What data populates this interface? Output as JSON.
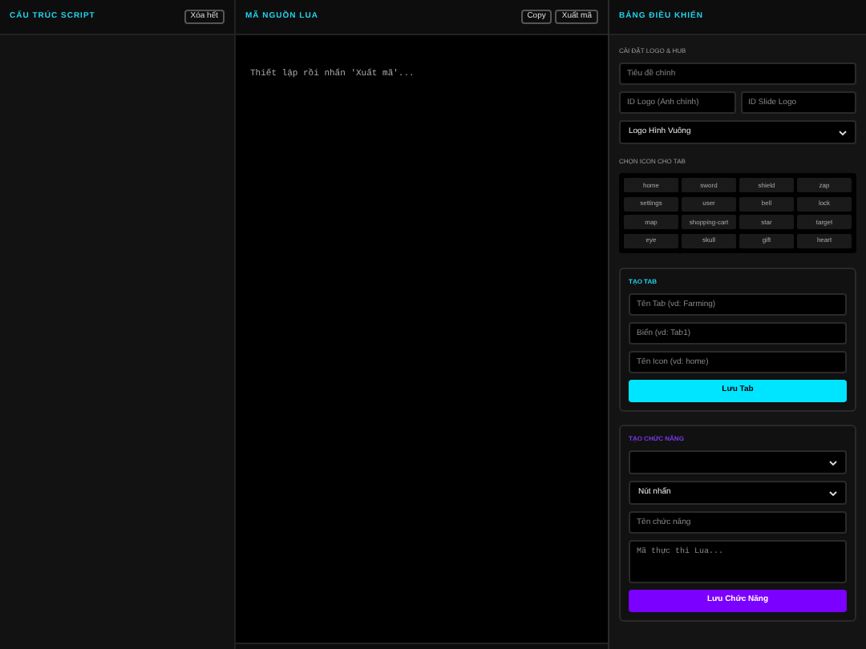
{
  "structure_panel": {
    "title": "CẤU TRÚC SCRIPT",
    "clear_button": "Xóa hết"
  },
  "code_panel": {
    "title": "MÃ NGUỒN LUA",
    "copy_button": "Copy",
    "export_button": "Xuất mã",
    "output": "Thiết lập rồi nhấn 'Xuất mã'..."
  },
  "control_panel": {
    "title": "BẢNG ĐIỀU KHIỂN",
    "logo_section": {
      "heading": "CÀI ĐẶT LOGO & HUB",
      "title_field": {
        "placeholder": "Tiêu đề chính"
      },
      "logo_id_field": {
        "placeholder": "ID Logo (Ảnh chính)"
      },
      "slide_logo_field": {
        "placeholder": "ID Slide Logo"
      },
      "logo_shape_select": {
        "value": "Logo Hình Vuông"
      }
    },
    "icon_section": {
      "heading": "CHỌN ICON CHO TAB",
      "icons": [
        "home",
        "sword",
        "shield",
        "zap",
        "settings",
        "user",
        "bell",
        "lock",
        "map",
        "shopping-cart",
        "star",
        "target",
        "eye",
        "skull",
        "gift",
        "heart"
      ]
    },
    "tab_card": {
      "heading": "TẠO TAB",
      "fields": [
        {
          "placeholder": "Tên Tab (vd: Farming)"
        },
        {
          "placeholder": "Biến (vd: Tab1)"
        },
        {
          "placeholder": "Tên Icon (vd: home)"
        }
      ],
      "save_button": "Lưu Tab"
    },
    "function_card": {
      "heading": "TẠO CHỨC NĂNG",
      "type_select": {
        "value": "Nút nhấn"
      },
      "name_field": {
        "placeholder": "Tên chức năng"
      },
      "code_field": {
        "placeholder": "Mã thực thi Lua..."
      },
      "save_button": "Lưu Chức Năng"
    }
  }
}
